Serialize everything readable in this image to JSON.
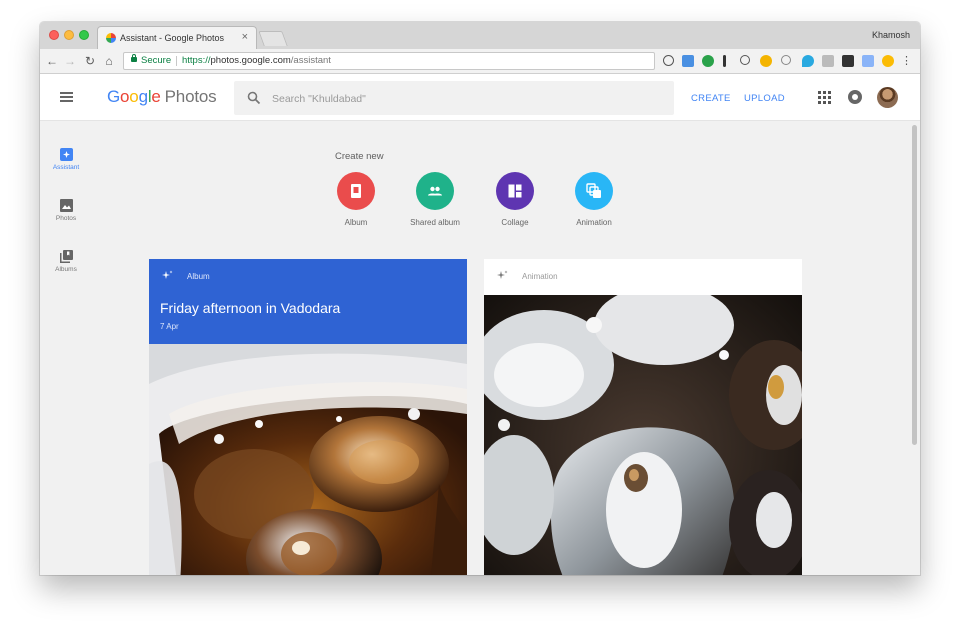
{
  "browser": {
    "tab": {
      "title": "Assistant - Google Photos",
      "close": "×"
    },
    "profile_name": "Khamosh",
    "nav": {
      "back": "←",
      "forward": "→",
      "reload": "↻",
      "home": "⌂"
    },
    "omnibox": {
      "secure_label": "Secure",
      "url_scheme": "https://",
      "url_host": "photos.google.com",
      "url_path": "/assistant"
    },
    "menu": "⋮"
  },
  "header": {
    "logo": {
      "g1": "G",
      "g2": "o",
      "g3": "o",
      "g4": "g",
      "g5": "l",
      "g6": "e",
      "product": "Photos"
    },
    "search": {
      "placeholder": "Search \"Khuldabad\""
    },
    "create_label": "CREATE",
    "upload_label": "UPLOAD"
  },
  "sidebar": {
    "items": [
      {
        "label": "Assistant",
        "icon": "assistant-icon",
        "active": true
      },
      {
        "label": "Photos",
        "icon": "photo-icon",
        "active": false
      },
      {
        "label": "Albums",
        "icon": "albums-icon",
        "active": false
      }
    ]
  },
  "create_new": {
    "title": "Create new",
    "items": [
      {
        "label": "Album",
        "icon": "album-icon",
        "color": "#ea4c4c"
      },
      {
        "label": "Shared album",
        "icon": "people-icon",
        "color": "#1fb28a"
      },
      {
        "label": "Collage",
        "icon": "collage-icon",
        "color": "#5e35b1"
      },
      {
        "label": "Animation",
        "icon": "animation-icon",
        "color": "#29b6f6"
      }
    ]
  },
  "cards": [
    {
      "type": "Album",
      "title": "Friday afternoon in Vadodara",
      "date": "7 Apr",
      "header_color": "#2f63d3"
    },
    {
      "type": "Animation"
    }
  ],
  "colors": {
    "accent": "#4285f4",
    "page_bg": "#f1f1f1"
  }
}
